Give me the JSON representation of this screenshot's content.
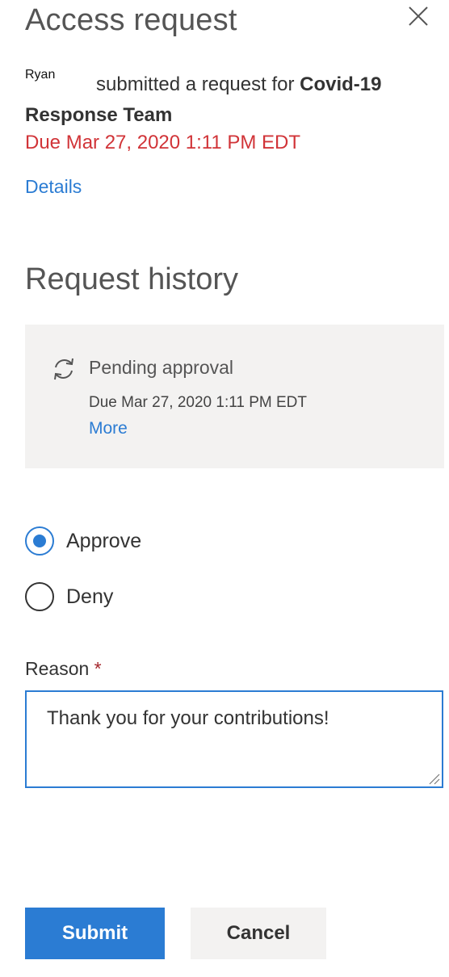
{
  "header": {
    "title": "Access request",
    "close_icon": "close-icon"
  },
  "request": {
    "requester": "Ryan",
    "action_text": "submitted a request for",
    "group_name": "Covid-19 Response Team",
    "due": "Due Mar 27, 2020 1:11 PM EDT",
    "details_link": "Details"
  },
  "history": {
    "title": "Request history",
    "icon": "sync-icon",
    "status": "Pending approval",
    "due": "Due Mar 27, 2020 1:11 PM EDT",
    "more_link": "More"
  },
  "decision": {
    "options": [
      {
        "label": "Approve",
        "selected": true
      },
      {
        "label": "Deny",
        "selected": false
      }
    ]
  },
  "reason": {
    "label": "Reason",
    "required_marker": "*",
    "value": "Thank you for your contributions!"
  },
  "actions": {
    "submit_label": "Submit",
    "cancel_label": "Cancel"
  },
  "colors": {
    "accent": "#2b7cd3",
    "due_red": "#d13438",
    "card_bg": "#f3f2f1"
  }
}
